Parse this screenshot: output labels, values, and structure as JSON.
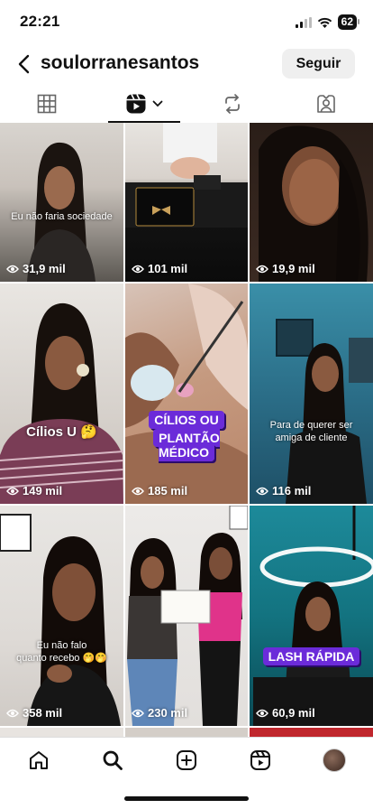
{
  "status": {
    "time": "22:21",
    "battery": "62"
  },
  "header": {
    "username": "soulorranesantos",
    "follow_label": "Seguir"
  },
  "tabs": [
    "grid-icon",
    "reels-icon",
    "reposts-icon",
    "tagged-icon"
  ],
  "posts": [
    {
      "views": "31,9 mil",
      "caption": "Eu não faria sociedade"
    },
    {
      "views": "101 mil",
      "caption": ""
    },
    {
      "views": "19,9 mil",
      "caption": ""
    },
    {
      "views": "149 mil",
      "caption": "Cílios U 🤔"
    },
    {
      "views": "185 mil",
      "caption": "",
      "sticker_1": "CÍLIOS OU",
      "sticker_2": "PLANTÃO MÉDICO"
    },
    {
      "views": "116 mil",
      "caption_1": "Para de querer ser",
      "caption_2": "amiga de cliente"
    },
    {
      "views": "358 mil",
      "caption_1": "Eu não falo",
      "caption_2": "quanto recebo 🤭🤭"
    },
    {
      "views": "230 mil",
      "caption": ""
    },
    {
      "views": "60,9 mil",
      "sticker": "LASH RÁPIDA"
    }
  ],
  "nav": [
    "home-icon",
    "search-icon",
    "create-icon",
    "reels-icon",
    "profile-avatar"
  ]
}
